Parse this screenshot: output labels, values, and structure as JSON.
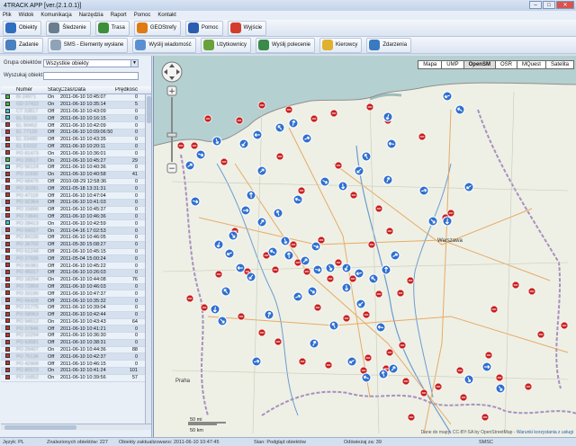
{
  "window": {
    "title": "4TRACK APP [ver.(2.1.0.1)]",
    "buttons": [
      "–",
      "□",
      "✕"
    ]
  },
  "menu": [
    "Plik",
    "Widok",
    "Komunikacja",
    "Narzędzia",
    "Raport",
    "Pomoc",
    "Kontakt"
  ],
  "toolbar1": [
    {
      "label": "Obiekty",
      "icon": "car-icon",
      "color": "#2f6fc0"
    },
    {
      "label": "Śledzenie",
      "icon": "wrench-icon",
      "color": "#6a7d8f"
    },
    {
      "label": "Trasa",
      "icon": "route-icon",
      "color": "#3d8f3a"
    },
    {
      "label": "GEOStrefy",
      "icon": "geofence-icon",
      "color": "#e07a12"
    },
    {
      "label": "Pomoc",
      "icon": "help-icon",
      "color": "#2a5db0"
    },
    {
      "label": "Wyjście",
      "icon": "power-icon",
      "color": "#d23c2c"
    }
  ],
  "toolbar2": [
    {
      "label": "Zadanie",
      "icon": "task-icon",
      "color": "#4a7fc0"
    },
    {
      "label": "SMS - Elementy wysłane",
      "icon": "sms-icon",
      "color": "#8fa3b8"
    },
    {
      "label": "Wyślij wiadomość",
      "icon": "send-message-icon",
      "color": "#5c8fd0"
    },
    {
      "label": "Użytkownicy",
      "icon": "users-icon",
      "color": "#6aa23a"
    },
    {
      "label": "Wyślij polecenie",
      "icon": "send-command-icon",
      "color": "#3a8a4a"
    },
    {
      "label": "Kierowcy",
      "icon": "drivers-icon",
      "color": "#e0b030"
    },
    {
      "label": "Zdarzenia",
      "icon": "events-icon",
      "color": "#3a7ac0"
    }
  ],
  "filters": {
    "group_label": "Grupa obiektów",
    "group_value": "Wszystkie obiekty",
    "search_label": "Wyszukaj obiekt",
    "search_value": ""
  },
  "grid": {
    "headers": [
      "",
      "Numer",
      "Stacyjka",
      "Czas/Data",
      "Prędkość"
    ],
    "rows": [
      {
        "color": "#3fbf3f",
        "numer": "BI 24971",
        "stacyjka": "On",
        "czas": "2011-06-10 10:45:07",
        "predkosc": "0"
      },
      {
        "color": "#3fbf3f",
        "numer": "GD 07422",
        "stacyjka": "On",
        "czas": "2011-06-10 10:35:14",
        "predkosc": "5"
      },
      {
        "color": "#40c8c8",
        "numer": "CT 33817",
        "stacyjka": "Off",
        "czas": "2011-06-10 10:43:09",
        "predkosc": "0"
      },
      {
        "color": "#40c8c8",
        "numer": "EL 51193",
        "stacyjka": "Off",
        "czas": "2011-06-10 10:16:15",
        "predkosc": "0"
      },
      {
        "color": "#c8302c",
        "numer": "EL 90452",
        "stacyjka": "Off",
        "czas": "2011-06-10 10:42:09",
        "predkosc": "0"
      },
      {
        "color": "#c8302c",
        "numer": "EL 77120",
        "stacyjka": "Off",
        "czas": "2011-06-10 10:09:06:50",
        "predkosc": "0"
      },
      {
        "color": "#c8302c",
        "numer": "EL 33489",
        "stacyjka": "Off",
        "czas": "2011-06-10 10:43:35",
        "predkosc": "0"
      },
      {
        "color": "#c8302c",
        "numer": "EL 61022",
        "stacyjka": "Off",
        "czas": "2011-06-10 10:20:11",
        "predkosc": "0"
      },
      {
        "color": "#c8302c",
        "numer": "PO 81473",
        "stacyjka": "On",
        "czas": "2011-06-10 10:36:01",
        "predkosc": "0"
      },
      {
        "color": "#3fbf3f",
        "numer": "PO 20517",
        "stacyjka": "On",
        "czas": "2011-06-10 10:45:27",
        "predkosc": "29"
      },
      {
        "color": "#40c8c8",
        "numer": "PO 56124",
        "stacyjka": "Off",
        "czas": "2011-06-10 10:40:36",
        "predkosc": "0"
      },
      {
        "color": "#c8302c",
        "numer": "PO 11930",
        "stacyjka": "On",
        "czas": "2011-06-10 10:40:58",
        "predkosc": "41"
      },
      {
        "color": "#c8302c",
        "numer": "PO 68475",
        "stacyjka": "Off",
        "czas": "2010-08-29 12:58:36",
        "predkosc": "0"
      },
      {
        "color": "#c8302c",
        "numer": "PO 30281",
        "stacyjka": "Off",
        "czas": "2011-05-18 13:31:31",
        "predkosc": "0"
      },
      {
        "color": "#c8302c",
        "numer": "PO 47119",
        "stacyjka": "Off",
        "czas": "2011-06-10 10:47:04",
        "predkosc": "0"
      },
      {
        "color": "#c8302c",
        "numer": "PO 92364",
        "stacyjka": "Off",
        "czas": "2011-06-10 10:41:03",
        "predkosc": "0"
      },
      {
        "color": "#c8302c",
        "numer": "PO 15890",
        "stacyjka": "Off",
        "czas": "2011-06-10 10:45:37",
        "predkosc": "0"
      },
      {
        "color": "#c8302c",
        "numer": "PO 73641",
        "stacyjka": "Off",
        "czas": "2011-06-10 10:46:36",
        "predkosc": "0"
      },
      {
        "color": "#40c8c8",
        "numer": "PO 28413",
        "stacyjka": "On",
        "czas": "2011-06-10 10:42:59",
        "predkosc": "0"
      },
      {
        "color": "#c8302c",
        "numer": "PO 59027",
        "stacyjka": "On",
        "czas": "2011-04-16 17:02:53",
        "predkosc": "0"
      },
      {
        "color": "#c8302c",
        "numer": "PO 84156",
        "stacyjka": "Off",
        "czas": "2011-06-10 10:46:05",
        "predkosc": "0"
      },
      {
        "color": "#c8302c",
        "numer": "PO 36702",
        "stacyjka": "Off",
        "czas": "2011-05-30 15:08:27",
        "predkosc": "0"
      },
      {
        "color": "#c8302c",
        "numer": "PO 61248",
        "stacyjka": "Off",
        "czas": "2011-06-10 10:45:15",
        "predkosc": "0"
      },
      {
        "color": "#c8302c",
        "numer": "PO 27935",
        "stacyjka": "Off",
        "czas": "2011-05-04 15:00:24",
        "predkosc": "0"
      },
      {
        "color": "#c8302c",
        "numer": "PO 90381",
        "stacyjka": "Off",
        "czas": "2011-06-10 10:45:22",
        "predkosc": "0"
      },
      {
        "color": "#c8302c",
        "numer": "PO 45017",
        "stacyjka": "Off",
        "czas": "2011-06-10 10:26:03",
        "predkosc": "0"
      },
      {
        "color": "#c8302c",
        "numer": "PO 18264",
        "stacyjka": "On",
        "czas": "2011-06-10 10:44:08",
        "predkosc": "76"
      },
      {
        "color": "#c8302c",
        "numer": "PO 72859",
        "stacyjka": "Off",
        "czas": "2011-06-10 10:46:03",
        "predkosc": "0"
      },
      {
        "color": "#c8302c",
        "numer": "PO 33190",
        "stacyjka": "Off",
        "czas": "2011-06-10 10:47:37",
        "predkosc": "0"
      },
      {
        "color": "#c8302c",
        "numer": "PO 66428",
        "stacyjka": "Off",
        "czas": "2011-06-10 10:35:32",
        "predkosc": "0"
      },
      {
        "color": "#c8302c",
        "numer": "PO 21775",
        "stacyjka": "Off",
        "czas": "2011-06-10 10:39:04",
        "predkosc": "0"
      },
      {
        "color": "#c8302c",
        "numer": "PO 58063",
        "stacyjka": "Off",
        "czas": "2011-06-10 10:42:44",
        "predkosc": "0"
      },
      {
        "color": "#c8302c",
        "numer": "PO 94512",
        "stacyjka": "On",
        "czas": "2011-06-10 10:43:43",
        "predkosc": "64"
      },
      {
        "color": "#c8302c",
        "numer": "PO 37846",
        "stacyjka": "Off",
        "czas": "2011-06-10 10:41:21",
        "predkosc": "0"
      },
      {
        "color": "#c8302c",
        "numer": "PO 10294",
        "stacyjka": "Off",
        "czas": "2011-06-10 10:36:30",
        "predkosc": "0"
      },
      {
        "color": "#c8302c",
        "numer": "PO 63581",
        "stacyjka": "Off",
        "czas": "2011-06-10 10:38:31",
        "predkosc": "0"
      },
      {
        "color": "#c8302c",
        "numer": "PO 29407",
        "stacyjka": "On",
        "czas": "2011-06-10 10:44:36",
        "predkosc": "88"
      },
      {
        "color": "#c8302c",
        "numer": "PO 75136",
        "stacyjka": "Off",
        "czas": "2011-06-10 10:42:37",
        "predkosc": "0"
      },
      {
        "color": "#c8302c",
        "numer": "PO 42968",
        "stacyjka": "Off",
        "czas": "2011-06-10 10:46:15",
        "predkosc": "0"
      },
      {
        "color": "#c8302c",
        "numer": "PO 80573",
        "stacyjka": "On",
        "czas": "2011-06-10 10:41:24",
        "predkosc": "101"
      },
      {
        "color": "#c8302c",
        "numer": "PO 16852",
        "stacyjka": "On",
        "czas": "2011-06-10 10:39:56",
        "predkosc": "57"
      }
    ]
  },
  "map": {
    "tabs": [
      "Mapa",
      "UMP",
      "OpenSM",
      "OSR",
      "MQuest",
      "Satelita"
    ],
    "active_tab": "OpenSM",
    "zoom_plus": "+",
    "zoom_minus": "−",
    "pan_icon": "pan-control-icon",
    "scale_labels": [
      "50 mi",
      "50 km"
    ],
    "cities": [
      "Warszawa",
      "Praha"
    ],
    "attribution": "Dane do mapy: CC-BY-SA by OpenStreetMap -",
    "attribution_link": "Warunki korzystania z usługi"
  },
  "status": {
    "language": "Język: PL",
    "found": "Znalezionych obiektów: 227",
    "loaded": "Obiekty zaktualizowano: 2011-06-10 10:47:45",
    "state": "Stan: Podgląd obiektów",
    "refresh": "Odświeżaj za: 39",
    "smsc": "SMSC"
  }
}
